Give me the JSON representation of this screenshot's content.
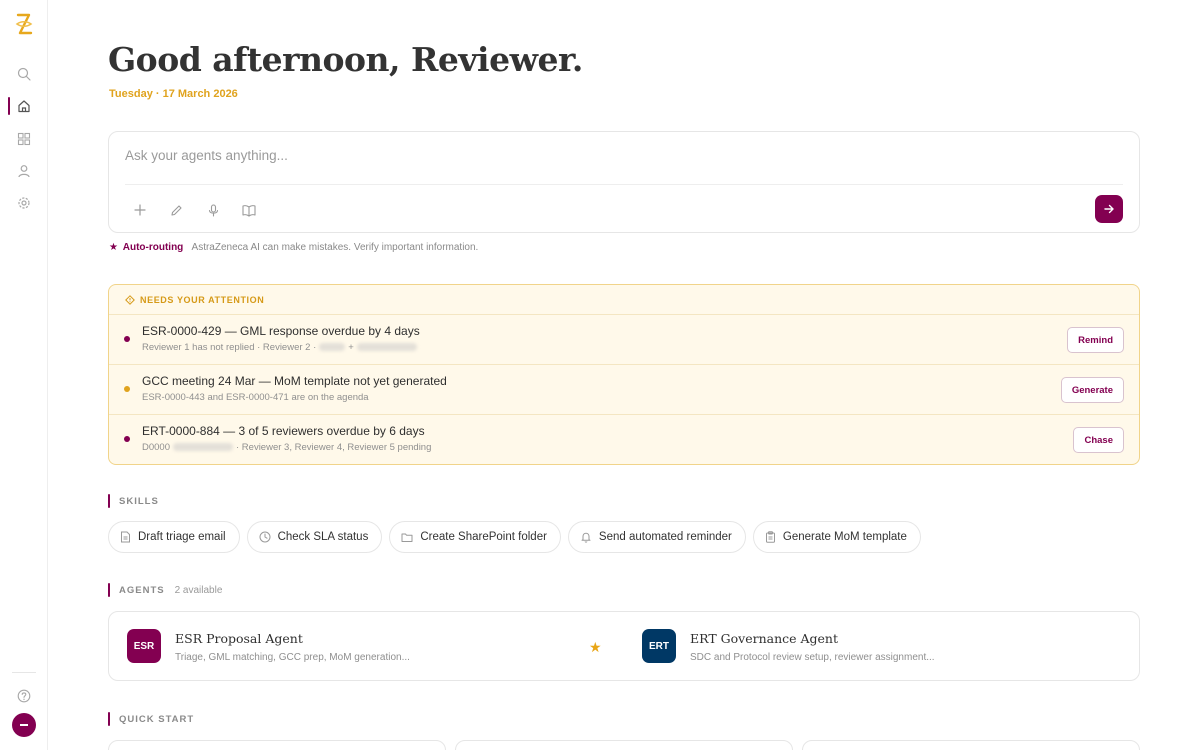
{
  "sidebar": {
    "logo_icon": "astrazeneca-logo-icon",
    "items": [
      {
        "name": "search",
        "icon": "search-icon"
      },
      {
        "name": "home",
        "icon": "home-icon",
        "active": true
      },
      {
        "name": "apps",
        "icon": "grid-icon"
      },
      {
        "name": "profile",
        "icon": "user-icon"
      },
      {
        "name": "settings",
        "icon": "gear-icon"
      }
    ],
    "help_icon": "help-icon",
    "avatar_icon": "minus-icon",
    "accent": "#830051"
  },
  "greeting": "Good afternoon, Reviewer.",
  "date": "Tuesday · 17 March 2026",
  "composer": {
    "placeholder": "Ask your agents anything...",
    "tools": [
      "plus-icon",
      "pencil-icon",
      "microphone-icon",
      "book-icon"
    ],
    "send_icon": "arrow-right-icon"
  },
  "routing": {
    "label": "Auto-routing",
    "disclaimer": "AstraZeneca AI can make mistakes. Verify important information."
  },
  "attention": {
    "header": "NEEDS YOUR ATTENTION",
    "items": [
      {
        "title": "ESR-0000-429 — GML response overdue by 4 days",
        "sub_prefix": "Reviewer 1 has not replied · Reviewer 2 ·",
        "sub_mid": "+",
        "sub_suffix": "",
        "dot_color": "#830051",
        "action": "Remind"
      },
      {
        "title": "GCC meeting 24 Mar — MoM template not yet generated",
        "sub_prefix": "ESR-0000-443 and ESR-0000-471 are on the agenda",
        "sub_mid": "",
        "sub_suffix": "",
        "dot_color": "#e0a31e",
        "action": "Generate"
      },
      {
        "title": "ERT-0000-884 — 3 of 5 reviewers overdue by 6 days",
        "sub_prefix": "D0000",
        "sub_mid": "",
        "sub_suffix": "· Reviewer 3, Reviewer 4, Reviewer 5 pending",
        "dot_color": "#830051",
        "action": "Chase"
      }
    ]
  },
  "skills": {
    "header": "SKILLS",
    "items": [
      {
        "label": "Draft triage email",
        "icon": "document-icon"
      },
      {
        "label": "Check SLA status",
        "icon": "clock-icon"
      },
      {
        "label": "Create SharePoint folder",
        "icon": "folder-icon"
      },
      {
        "label": "Send automated reminder",
        "icon": "bell-icon"
      },
      {
        "label": "Generate MoM template",
        "icon": "clipboard-icon"
      }
    ]
  },
  "agents": {
    "header": "AGENTS",
    "count": "2 available",
    "items": [
      {
        "badge": "ESR",
        "name": "ESR Proposal Agent",
        "description": "Triage, GML matching, GCC prep, MoM generation...",
        "color": "#830051",
        "starred": true
      },
      {
        "badge": "ERT",
        "name": "ERT Governance Agent",
        "description": "SDC and Protocol review setup, reviewer assignment...",
        "color": "#003865"
      }
    ]
  },
  "quick_start": {
    "header": "QUICK START"
  }
}
